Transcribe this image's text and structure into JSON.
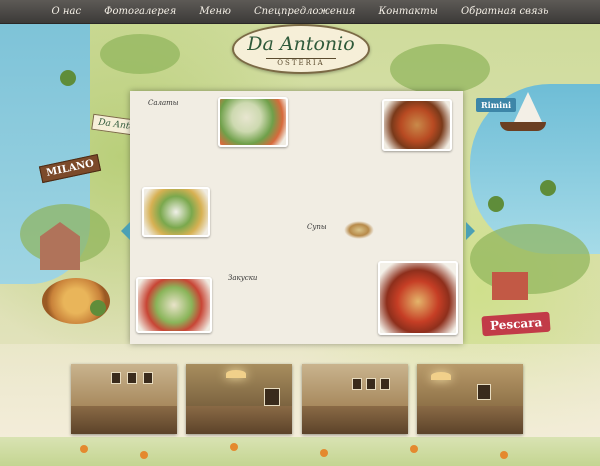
{
  "nav": {
    "items": [
      {
        "label": "О нас"
      },
      {
        "label": "Фотогалерея"
      },
      {
        "label": "Меню"
      },
      {
        "label": "Спецпредложения"
      },
      {
        "label": "Контакты"
      },
      {
        "label": "Обратная связь"
      }
    ]
  },
  "logo": {
    "name": "Da Antonio",
    "sub": "OSTERIA"
  },
  "map": {
    "milano": "MILANO",
    "pescara": "Pescara",
    "rimini": "Rimini",
    "badge": "Da Antonio"
  },
  "menu": {
    "left": {
      "salads": {
        "title": "Салаты"
      },
      "appetizers": {
        "title": "Закуски"
      }
    },
    "right": {
      "soups": {
        "title": "Супы"
      }
    }
  }
}
